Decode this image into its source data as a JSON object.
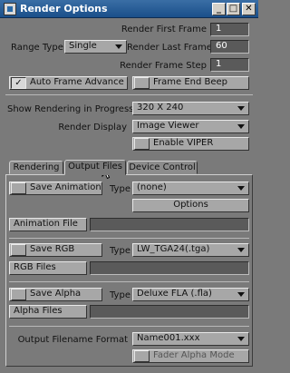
{
  "window": {
    "title": "Render Options",
    "minimize": "_",
    "maximize": "□",
    "close": "✕"
  },
  "range": {
    "type_label": "Range Type",
    "type_value": "Single",
    "first_label": "Render First Frame",
    "first_value": "1",
    "last_label": "Render Last Frame",
    "last_value": "60",
    "step_label": "Render Frame Step",
    "step_value": "1"
  },
  "toggles": {
    "auto_advance_label": "Auto Frame Advance",
    "auto_advance_check": "✓",
    "end_beep_label": "Frame End Beep"
  },
  "display": {
    "progress_label": "Show Rendering in Progress",
    "progress_value": "320 X 240",
    "render_display_label": "Render Display",
    "render_display_value": "Image Viewer",
    "mpeg_label": "Enable VIPER"
  },
  "tabs": [
    {
      "label": "Rendering"
    },
    {
      "label": "Output Files"
    },
    {
      "label": "Device Control"
    }
  ],
  "animation": {
    "save_label": "Save Animation",
    "type_label": "Type",
    "type_value": "(none)",
    "options_label": "Options",
    "file_label": "Animation File",
    "file_value": ""
  },
  "rgb": {
    "save_label": "Save RGB",
    "type_label": "Type",
    "type_value": "LW_TGA24(.tga)",
    "files_label": "RGB Files",
    "files_value": ""
  },
  "alpha": {
    "save_label": "Save Alpha",
    "type_label": "Type",
    "type_value": "Deluxe FLA (.fla)",
    "files_label": "Alpha Files",
    "files_value": ""
  },
  "output": {
    "format_label": "Output Filename Format",
    "format_value": "Name001.xxx",
    "fader_label": "Fader Alpha Mode"
  }
}
